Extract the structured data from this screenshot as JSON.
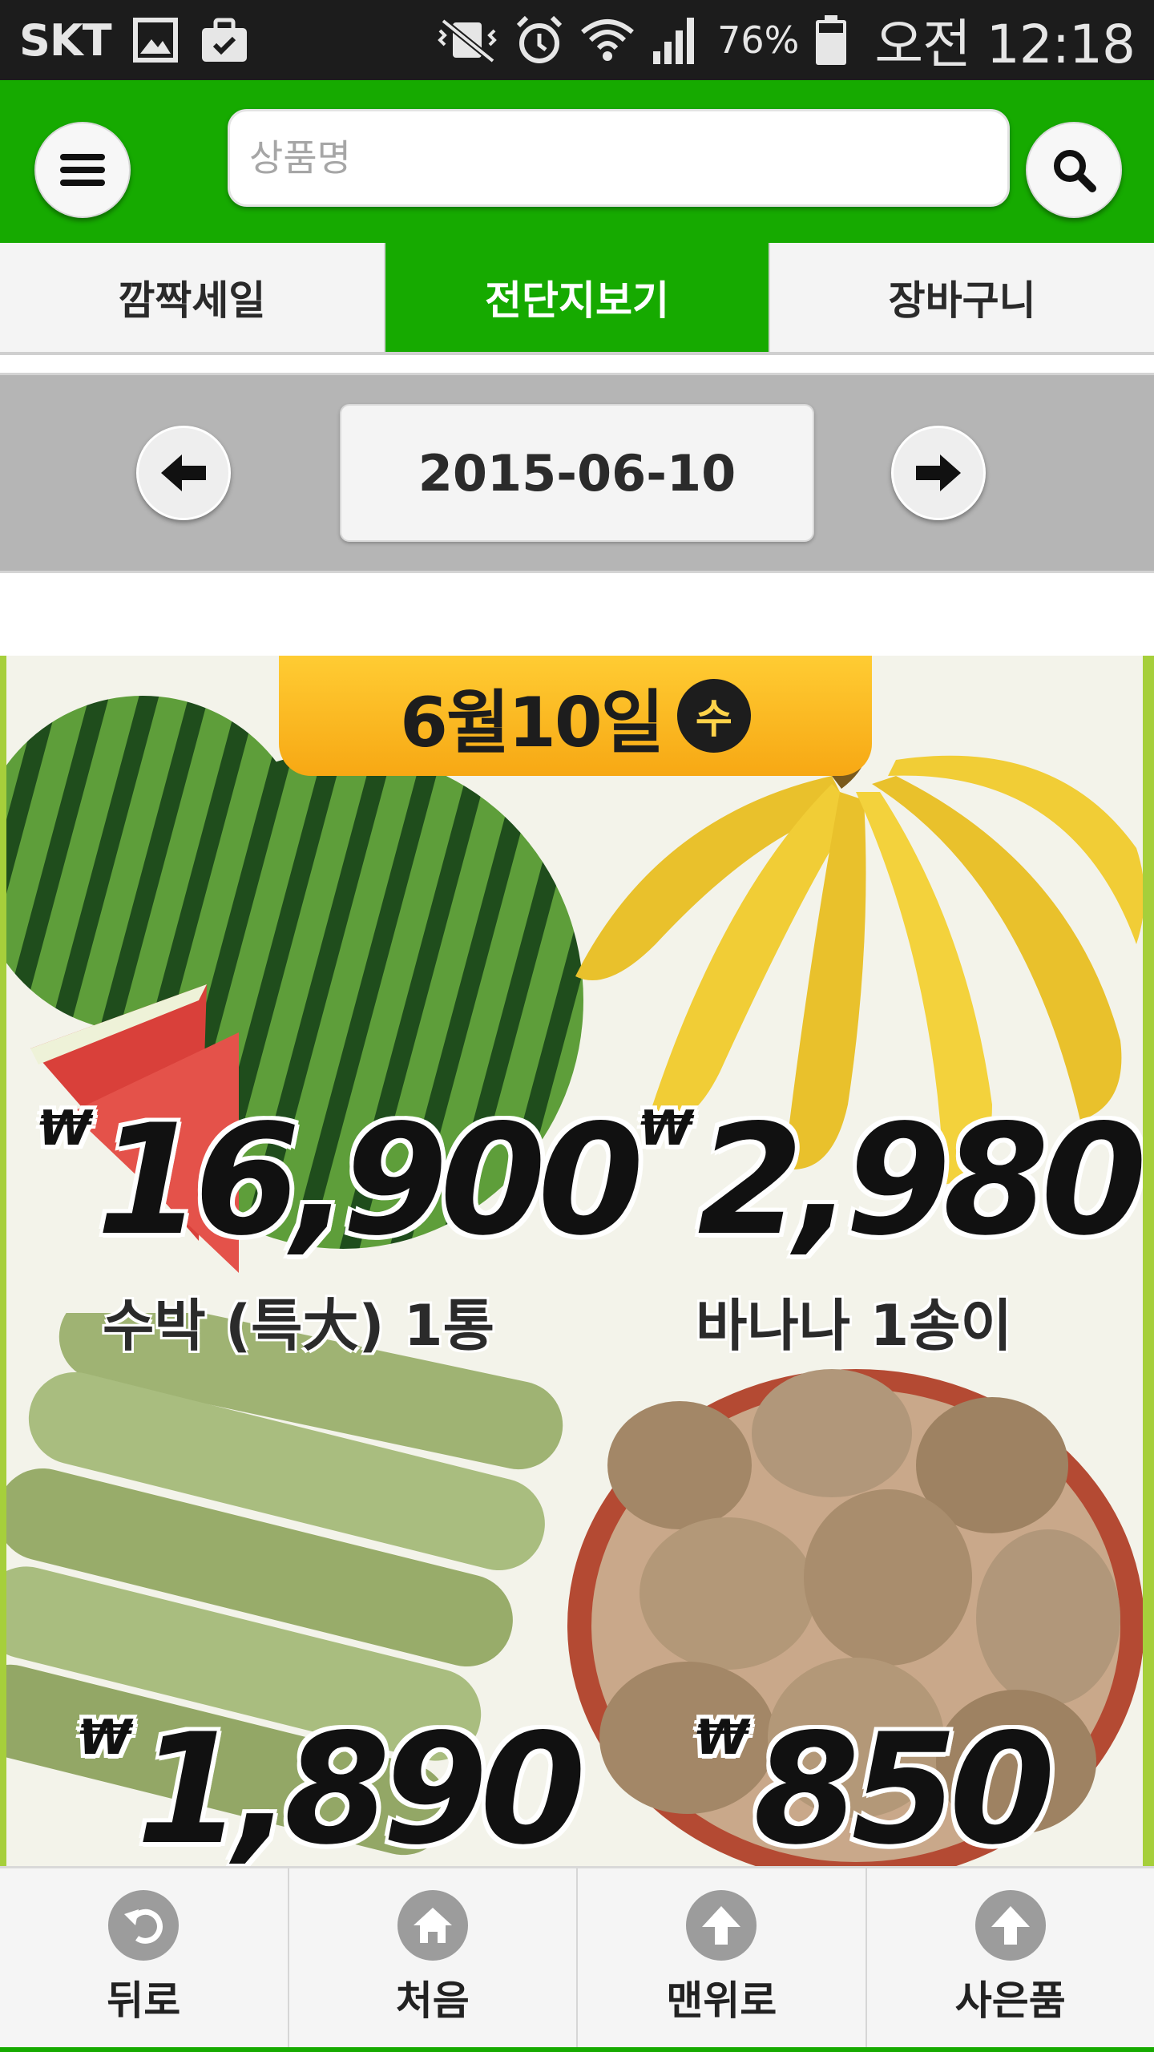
{
  "status_bar": {
    "carrier": "SKT",
    "battery_percent": "76%",
    "time": "오전 12:18",
    "left_icons": [
      "gallery-icon",
      "briefcase-icon"
    ],
    "right_icons": [
      "vibrate-mute-icon",
      "alarm-icon",
      "wifi-icon",
      "signal-icon",
      "battery-icon"
    ]
  },
  "header": {
    "search_placeholder": "상품명",
    "menu_icon": "hamburger-menu-icon",
    "search_icon": "magnifier-icon",
    "brand_color": "#16aa00"
  },
  "tabs": [
    {
      "label": "깜짝세일",
      "active": false
    },
    {
      "label": "전단지보기",
      "active": true
    },
    {
      "label": "장바구니",
      "active": false
    }
  ],
  "date_nav": {
    "date": "2015-06-10",
    "prev_icon": "arrow-left-icon",
    "next_icon": "arrow-right-icon"
  },
  "flyer": {
    "banner_date": "6월10일",
    "banner_day": "수",
    "items": [
      {
        "name": "수박 (특大) 1통",
        "price": "16,900",
        "currency": "₩"
      },
      {
        "name": "바나나 1송이",
        "price": "2,980",
        "currency": "₩"
      },
      {
        "name": "",
        "price": "1,890",
        "currency": "₩"
      },
      {
        "name": "",
        "price": "850",
        "currency": "₩"
      }
    ]
  },
  "bottom_nav": [
    {
      "label": "뒤로",
      "icon": "back-icon"
    },
    {
      "label": "처음",
      "icon": "home-icon"
    },
    {
      "label": "맨위로",
      "icon": "arrow-up-icon"
    },
    {
      "label": "사은품",
      "icon": "arrow-up-icon"
    }
  ]
}
